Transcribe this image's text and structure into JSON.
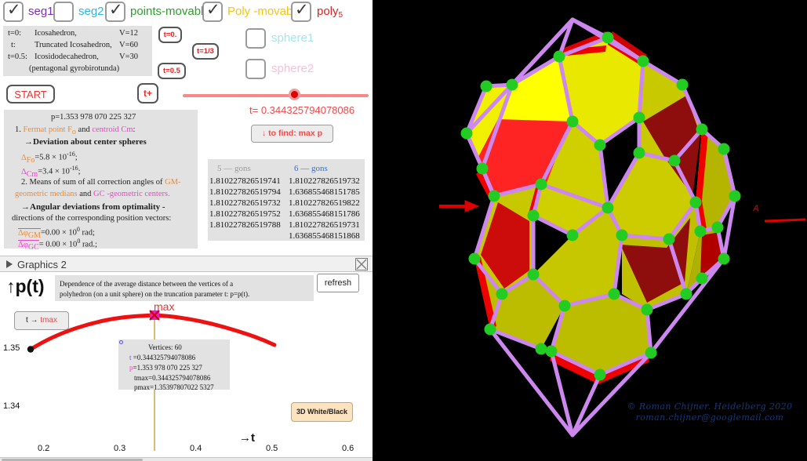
{
  "checkboxes": [
    {
      "name": "seg1",
      "label": "seg1",
      "checked": true,
      "color": "#7b2fbe"
    },
    {
      "name": "seg2",
      "label": "seg2",
      "checked": false,
      "color": "#30b4e8"
    },
    {
      "name": "points-movable",
      "label": "points-movable",
      "checked": true,
      "color": "#2e9e2e"
    },
    {
      "name": "poly-movable",
      "label": "Poly -movable",
      "checked": true,
      "color": "#f5c518"
    },
    {
      "name": "poly5",
      "label": "poly",
      "sub": "5",
      "checked": true,
      "color": "#e02020"
    },
    {
      "name": "sphere1",
      "label": "sphere1",
      "checked": false,
      "color": "#a8e4ee"
    },
    {
      "name": "sphere2",
      "label": "sphere2",
      "checked": false,
      "color": "#f8c2d4"
    }
  ],
  "info": {
    "rows": [
      {
        "k": "t=0:",
        "name": "Icosahedron,",
        "v": "V=12"
      },
      {
        "k": "t:",
        "name": "Truncated Icosahedron,",
        "v": "V=60"
      },
      {
        "k": "t=0.5:",
        "name": "Icosidodecahedron,",
        "v": "V=30"
      },
      {
        "k": "",
        "name": "(pentagonal gyrobirotunda)",
        "v": ""
      }
    ]
  },
  "buttons": {
    "start": "START",
    "t_plus": "t+",
    "t0": "t=0.",
    "t13": "t=1/3",
    "t05": "t=0.5",
    "find_max": "↓ to find: max p",
    "refresh": "refresh",
    "t_to_tmax_left": "t → ",
    "t_to_tmax_right": "tmax",
    "white_black": "3D White/Black"
  },
  "slider": {
    "value_label": "t= 0.344325794078086",
    "position_pct": 57
  },
  "stats": {
    "p_line": "p=1.353 978 070 225 327",
    "l1_num": "1.",
    "l1_a": "Fermat point",
    "l1_b": "F",
    "l1_bsub": "o",
    "l1_c": "and",
    "l1_d": "centroid",
    "l1_e": "Cm",
    "l1_f": ":",
    "l2": "→Deviation about center spheres",
    "l3_sym": "Δ",
    "l3_sub": "F",
    "l3_sub2": "o",
    "l3_val": "=5.8 × 10",
    "l3_exp": "-16",
    "l3_end": ";",
    "l4_sym": "Δ",
    "l4_sub": "Cm",
    "l4_val": "=3.4 × 10",
    "l4_exp": "-16",
    "l4_end": ";",
    "l5_a": "2. Means of sum of all correction angles of",
    "l5_b": "GM",
    "l5_c": "-",
    "l6_a": "geometric medians",
    "l6_b": "and",
    "l6_c": "GC",
    "l6_d": "-geometric centers.",
    "l7": "→Angular deviations from optimality -",
    "l8": "directions of the corresponding position vectors:",
    "l9_sym": "Δφ",
    "l9_sub": "GM",
    "l9_val": "=0.00 × 10",
    "l9_exp": "0",
    "l9_end": "rad;",
    "l10_sym": "Δφ",
    "l10_sub": "GC",
    "l10_val": "= 0.00 × 10",
    "l10_exp": "0",
    "l10_end": "rad.;"
  },
  "gons_table": {
    "headers": [
      "5 — gons",
      "6 — gons"
    ],
    "col5": [
      "1.810227826519741",
      "1.810227826519794",
      "1.810227826519732",
      "1.810227826519752",
      "1.810227826519788"
    ],
    "col6": [
      "1.810227826519732",
      "1.636855468151785",
      "1.810227826519822",
      "1.636855468151786",
      "1.810227826519731",
      "1.636855468151868"
    ]
  },
  "graphics2": {
    "title": "Graphics 2",
    "axis_label": "↑p(t)",
    "description_line1": "Dependence of the average distance between the vertices of a",
    "description_line2": "polyhedron (on a unit sphere) on the truncation parameter t: p=p(t).",
    "max_label": "max",
    "t_axis_label": "→t"
  },
  "tooltip": {
    "vertices": "Vertices: 60",
    "t_key": "t",
    "t_val": "=0.344325794078086",
    "p_key": "p",
    "p_val": "=1.353 978 070 225 327",
    "tmax": "tmax=0.344325794078086",
    "pmax": "pmax=1.35397807022 5327"
  },
  "chart_data": {
    "type": "line",
    "title": "Dependence of the average distance between the vertices of a polyhedron (on a unit sphere) on the truncation parameter t: p=p(t).",
    "xlabel": "→t",
    "ylabel": "↑p(t)",
    "xlim": [
      0.165,
      0.635
    ],
    "ylim": [
      1.3385,
      1.3545
    ],
    "xticks": [
      "0.2",
      "0.3",
      "0.4",
      "0.5",
      "0.6"
    ],
    "xtick_values": [
      0.2,
      0.3,
      0.4,
      0.5,
      0.6
    ],
    "yticks": [
      "1.35",
      "1.34"
    ],
    "ytick_values": [
      1.35,
      1.34
    ],
    "grid": false,
    "legend": false,
    "series": [
      {
        "name": "p(t)",
        "color": "#ee1111",
        "x": [
          0.185,
          0.21,
          0.235,
          0.26,
          0.285,
          0.31,
          0.3443,
          0.37,
          0.4,
          0.43,
          0.46,
          0.49,
          0.52,
          0.545
        ],
        "y": [
          1.3498,
          1.35135,
          1.35245,
          1.35325,
          1.35373,
          1.35394,
          1.353978,
          1.35386,
          1.35348,
          1.35284,
          1.35196,
          1.35083,
          1.34948,
          1.34827
        ]
      }
    ],
    "markers": [
      {
        "name": "start-point",
        "x": 0.185,
        "y": 1.3498,
        "color": "#000000"
      },
      {
        "name": "max-point",
        "x": 0.344325794078086,
        "y": 1.353978070225327,
        "color": "#e020c0",
        "label": "max"
      }
    ],
    "vertical_line": {
      "x": 0.344325794078086,
      "color": "#c8a040"
    }
  },
  "scene": {
    "copyright_line1": "©   Roman Chijner. Heidelberg 2020",
    "copyright_line2": "roman.chijner@googlemail.com",
    "a_label": "A",
    "colors": {
      "background": "#000000",
      "edge": "#cc88ee",
      "vertex": "#22cc22",
      "hex_light": "#ffff00",
      "hex_mid": "#cccc00",
      "pent_bright": "#ff2020",
      "pent_dark": "#991010",
      "pent_edge": "#ee0000"
    }
  }
}
